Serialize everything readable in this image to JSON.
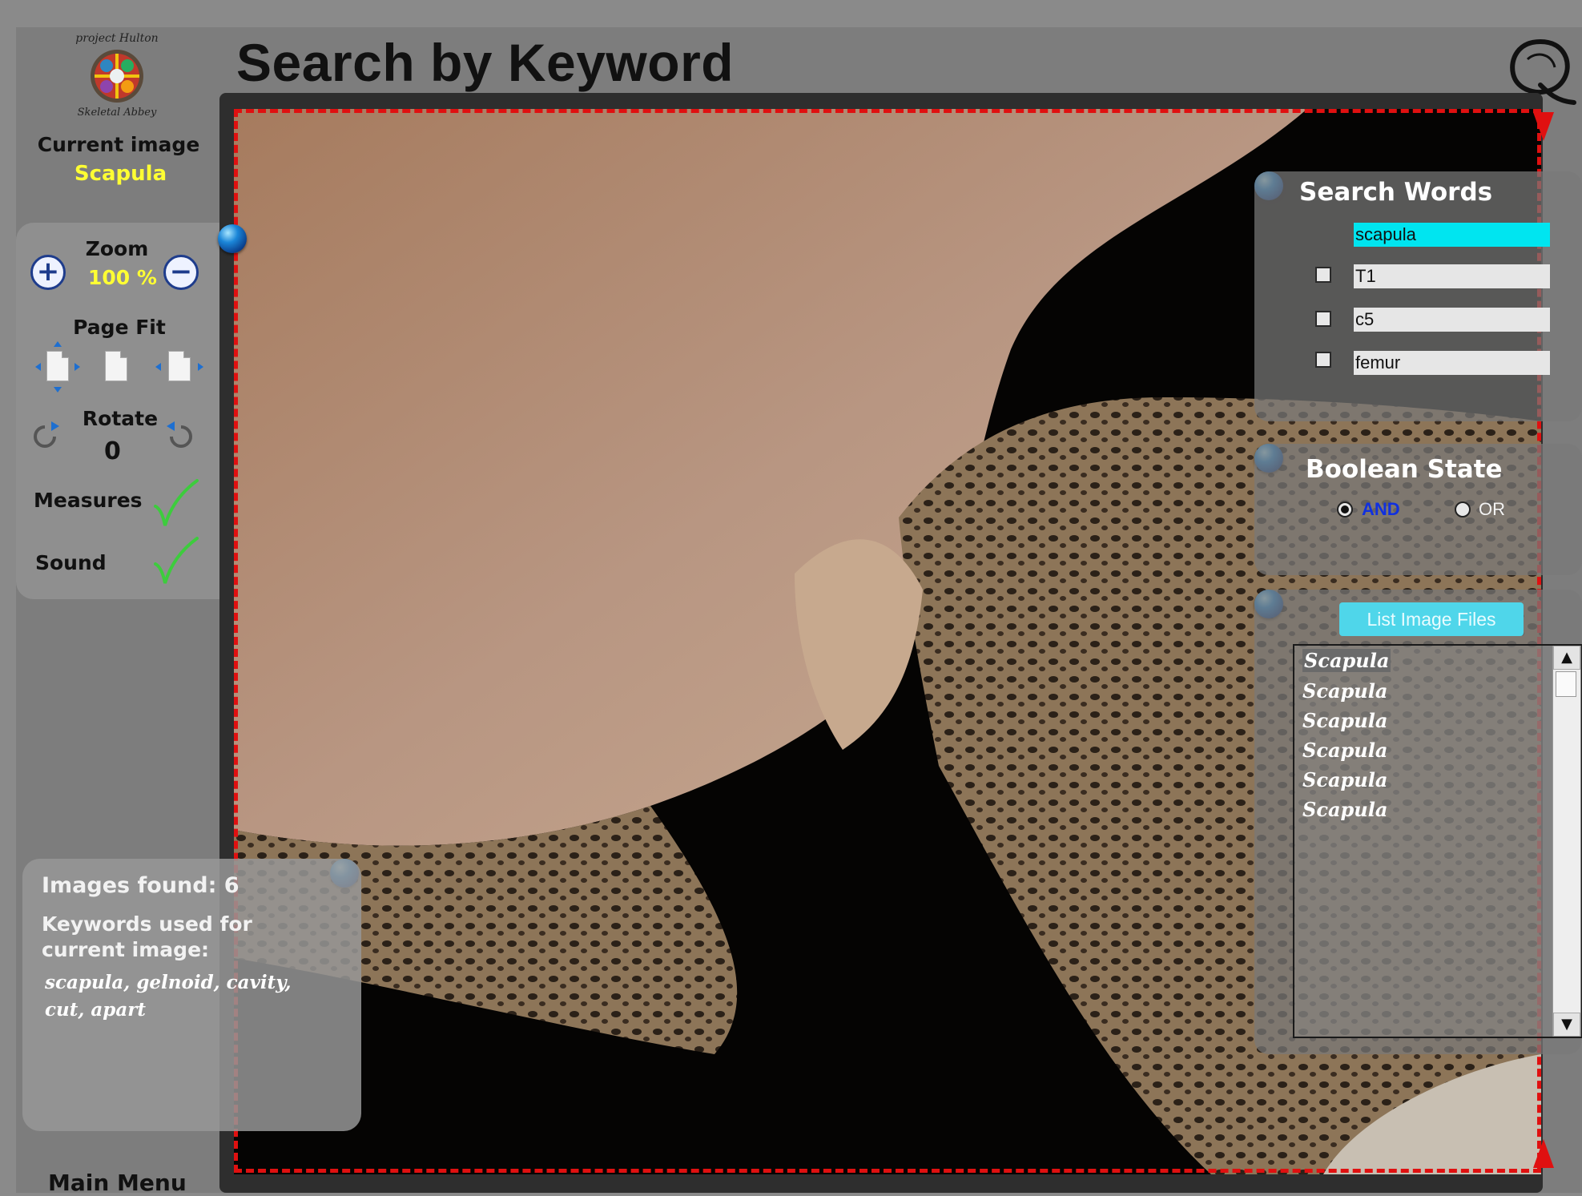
{
  "header": {
    "title": "Search by Keyword"
  },
  "left_panel": {
    "logo_text": "project Hulton Abbey Skeletal",
    "current_image_label": "Current image",
    "current_image_name": "Scapula",
    "zoom_label": "Zoom",
    "zoom_value": "100 %",
    "page_fit_label": "Page Fit",
    "rotate_label": "Rotate",
    "rotate_value": "0",
    "measures_label": "Measures",
    "sound_label": "Sound"
  },
  "info": {
    "images_found": "Images found: 6",
    "keywords_heading": "Keywords used for current image:",
    "keywords": "scapula, gelnoid, cavity, cut, apart"
  },
  "footer": {
    "main_menu": "Main Menu"
  },
  "search_words": {
    "title": "Search Words",
    "fields": [
      {
        "value": "scapula",
        "active": true
      },
      {
        "value": "T1",
        "checked": false
      },
      {
        "value": "c5",
        "checked": false
      },
      {
        "value": "femur",
        "checked": false
      }
    ]
  },
  "boolean_state": {
    "title": "Boolean State",
    "options": [
      {
        "label": "AND",
        "selected": true
      },
      {
        "label": "OR",
        "selected": false
      }
    ]
  },
  "results": {
    "button_label": "List Image Files",
    "items": [
      "Scapula",
      "Scapula",
      "Scapula",
      "Scapula",
      "Scapula",
      "Scapula"
    ]
  },
  "colors": {
    "accent_yellow": "#ffff33",
    "active_field": "#00e5f0",
    "frame_dash": "#e01010",
    "button_cyan": "#4fd6ea"
  }
}
